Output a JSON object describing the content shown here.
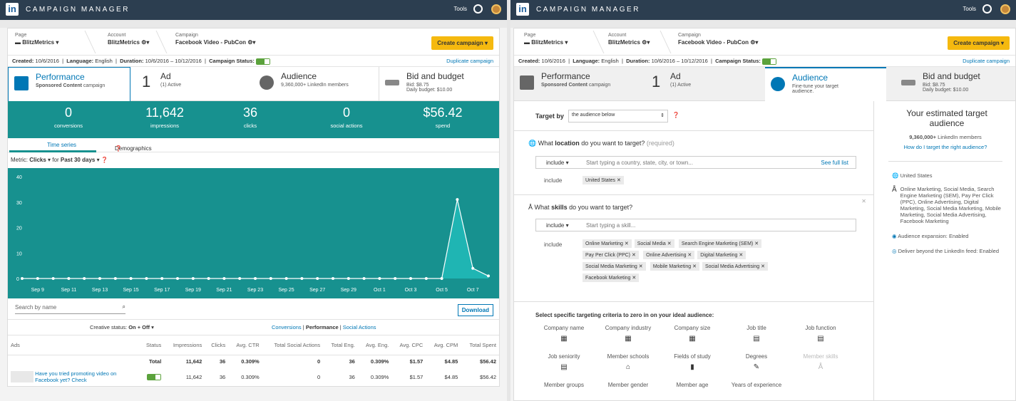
{
  "app": {
    "logo": "in",
    "title": "CAMPAIGN MANAGER",
    "tools": "Tools"
  },
  "breadcrumb": {
    "page_label": "Page",
    "page_value": "BlitzMetrics",
    "account_label": "Account",
    "account_value": "BlitzMetrics",
    "campaign_label": "Campaign",
    "campaign_value": "Facebook Video - PubCon"
  },
  "create_campaign": "Create campaign",
  "duplicate_campaign": "Duplicate campaign",
  "meta": {
    "created_label": "Created:",
    "created": "10/6/2016",
    "language_label": "Language:",
    "language": "English",
    "duration_label": "Duration:",
    "duration": "10/6/2016 – 10/12/2016",
    "status_label": "Campaign Status:"
  },
  "tabs": {
    "performance": {
      "title": "Performance",
      "sub_bold": "Sponsored Content",
      "sub": "campaign"
    },
    "ad": {
      "num": "1",
      "title": "Ad",
      "sub": "(1) Active"
    },
    "audience": {
      "title": "Audience",
      "sub_left": "9,360,000+ LinkedIn members",
      "sub_right": "Fine-tune your target audience."
    },
    "bid": {
      "title": "Bid and budget",
      "bid": "Bid: $8.75",
      "budget": "Daily budget: $10.00"
    }
  },
  "stats": [
    {
      "value": "0",
      "label": "conversions"
    },
    {
      "value": "11,642",
      "label": "impressions"
    },
    {
      "value": "36",
      "label": "clicks"
    },
    {
      "value": "0",
      "label": "social actions"
    },
    {
      "value": "$56.42",
      "label": "spend"
    }
  ],
  "subtabs": {
    "time_series": "Time series",
    "demographics": "Demographics"
  },
  "metric": {
    "prefix": "Metric:",
    "metric": "Clicks",
    "for": "for",
    "range": "Past 30 days"
  },
  "chart_data": {
    "type": "area",
    "categories": [
      "Sep 8",
      "Sep 9",
      "Sep 10",
      "Sep 11",
      "Sep 12",
      "Sep 13",
      "Sep 14",
      "Sep 15",
      "Sep 16",
      "Sep 17",
      "Sep 18",
      "Sep 19",
      "Sep 20",
      "Sep 21",
      "Sep 22",
      "Sep 23",
      "Sep 24",
      "Sep 25",
      "Sep 26",
      "Sep 27",
      "Sep 28",
      "Sep 29",
      "Sep 30",
      "Oct 1",
      "Oct 2",
      "Oct 3",
      "Oct 4",
      "Oct 5",
      "Oct 6",
      "Oct 7",
      "Oct 8"
    ],
    "values": [
      0,
      0,
      0,
      0,
      0,
      0,
      0,
      0,
      0,
      0,
      0,
      0,
      0,
      0,
      0,
      0,
      0,
      0,
      0,
      0,
      0,
      0,
      0,
      0,
      0,
      0,
      0,
      0,
      31,
      4,
      1
    ],
    "x_tick_labels": [
      "Sep 9",
      "Sep 11",
      "Sep 13",
      "Sep 15",
      "Sep 17",
      "Sep 19",
      "Sep 21",
      "Sep 23",
      "Sep 25",
      "Sep 27",
      "Sep 29",
      "Oct 1",
      "Oct 3",
      "Oct 5",
      "Oct 7"
    ],
    "y_ticks": [
      0,
      10,
      20,
      30,
      40
    ],
    "ylim": [
      0,
      40
    ]
  },
  "search": {
    "placeholder": "Search by name",
    "download": "Download"
  },
  "filter": {
    "label": "Creative status:",
    "value": "On + Off",
    "conversions": "Conversions",
    "performance": "Performance",
    "social": "Social Actions"
  },
  "table": {
    "headers": [
      "Ads",
      "Status",
      "Impressions",
      "Clicks",
      "Avg. CTR",
      "Total Social Actions",
      "Total Eng.",
      "Avg. Eng.",
      "Avg. CPC",
      "Avg. CPM",
      "Total Spent"
    ],
    "total": [
      "Total",
      "11,642",
      "36",
      "0.309%",
      "0",
      "36",
      "0.309%",
      "$1.57",
      "$4.85",
      "$56.42"
    ],
    "row": {
      "name": "Have you tried promoting video on Facebook yet? Check",
      "cells": [
        "11,642",
        "36",
        "0.309%",
        "0",
        "36",
        "0.309%",
        "$1.57",
        "$4.85",
        "$56.42"
      ]
    }
  },
  "audience": {
    "target_by_label": "Target by",
    "target_by_value": "the audience below",
    "location_q_pre": "What",
    "location_q_bold": "location",
    "location_q_post": "do you want to target?",
    "required": "(required)",
    "include": "include",
    "location_placeholder": "Start typing a country, state, city, or town...",
    "see_full_list": "See full list",
    "location_chip": "United States",
    "skills_q_pre": "What",
    "skills_q_bold": "skills",
    "skills_q_post": "do you want to target?",
    "skills_placeholder": "Start typing a skill...",
    "skills": [
      "Online Marketing",
      "Social Media",
      "Search Engine Marketing (SEM)",
      "Pay Per Click (PPC)",
      "Online Advertising",
      "Digital Marketing",
      "Social Media Marketing",
      "Mobile Marketing",
      "Social Media Advertising",
      "Facebook Marketing"
    ],
    "criteria_heading": "Select specific targeting criteria to zero in on your ideal audience:",
    "criteria": [
      "Company name",
      "Company industry",
      "Company size",
      "Job title",
      "Job function",
      "Job seniority",
      "Member schools",
      "Fields of study",
      "Degrees",
      "Member skills",
      "Member groups",
      "Member gender",
      "Member age",
      "Years of experience"
    ]
  },
  "estimate": {
    "title": "Your estimated target audience",
    "count_bold": "9,360,000+",
    "count": "LinkedIn members",
    "how": "How do I target the right audience?",
    "location": "United States",
    "skills": "Online Marketing, Social Media, Search Engine Marketing (SEM), Pay Per Click (PPC), Online Advertising, Digital Marketing, Social Media Marketing, Mobile Marketing, Social Media Advertising, Facebook Marketing",
    "expansion": "Audience expansion: Enabled",
    "deliver": "Deliver beyond the LinkedIn feed: Enabled"
  }
}
